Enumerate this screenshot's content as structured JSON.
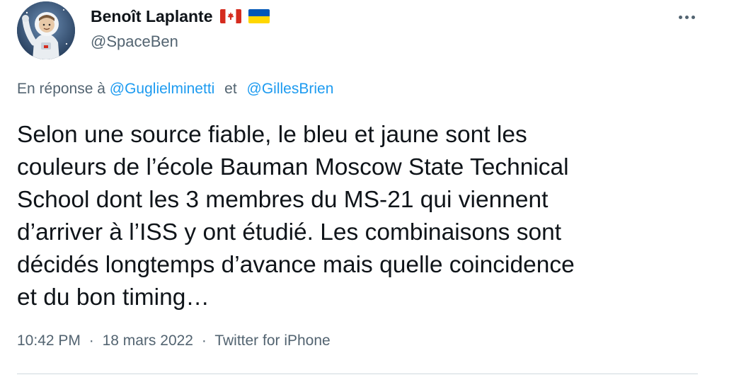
{
  "author": {
    "display_name": "Benoît Laplante",
    "handle": "@SpaceBen",
    "flags": [
      "canada-flag-icon",
      "ukraine-flag-icon"
    ]
  },
  "reply": {
    "prefix": "En réponse à",
    "mentions": [
      "@Guglielminetti",
      "@GillesBrien"
    ],
    "joiner": "et"
  },
  "tweet": {
    "lines": [
      "Selon une source fiable, le bleu et jaune sont les",
      "couleurs de l’école Bauman Moscow State Technical",
      "School dont les 3 membres du MS-21 qui viennent",
      "d’arriver à l’ISS y ont étudié. Les combinaisons sont",
      "décidés longtemps d’avance mais quelle coincidence",
      "et du bon timing…"
    ]
  },
  "meta": {
    "time": "10:42 PM",
    "date": "18 mars 2022",
    "source": "Twitter for iPhone",
    "separator": "·"
  },
  "colors": {
    "text": "#0f1419",
    "secondary": "#536471",
    "link": "#1d9bf0",
    "divider": "#cfd9de"
  }
}
